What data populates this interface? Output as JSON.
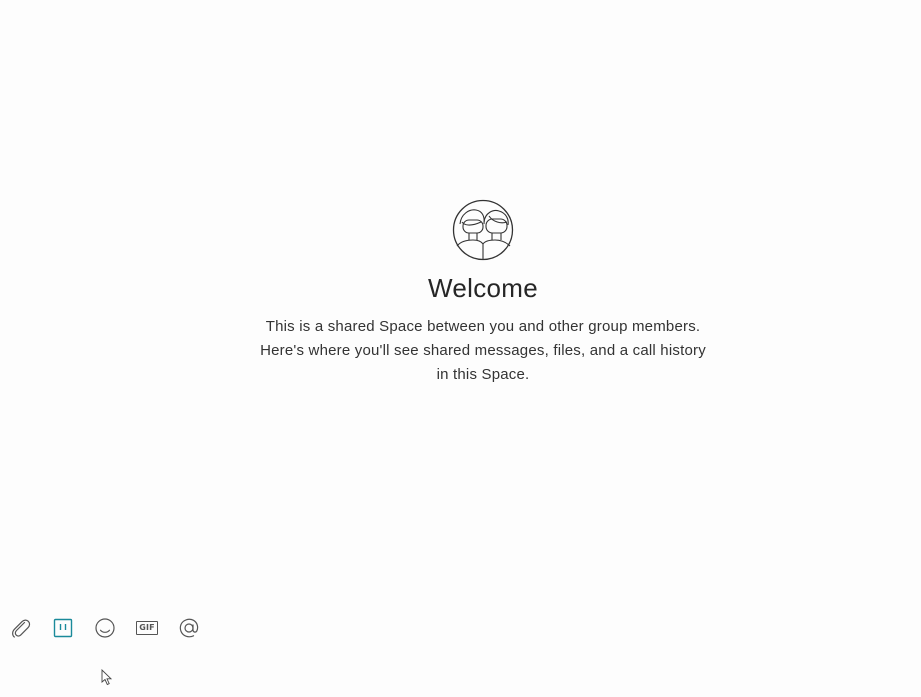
{
  "welcome": {
    "title": "Welcome",
    "description_lines": [
      "This is a shared Space between you and other group members.",
      "Here's where you'll see shared messages, files, and a call history",
      "in this Space."
    ]
  },
  "toolbar": {
    "icons": [
      "paperclip-icon",
      "whiteboard-icon",
      "emoji-icon",
      "gif-icon",
      "mention-icon"
    ],
    "gif_label": "GIF",
    "accent_color": "#1a8a9a"
  }
}
